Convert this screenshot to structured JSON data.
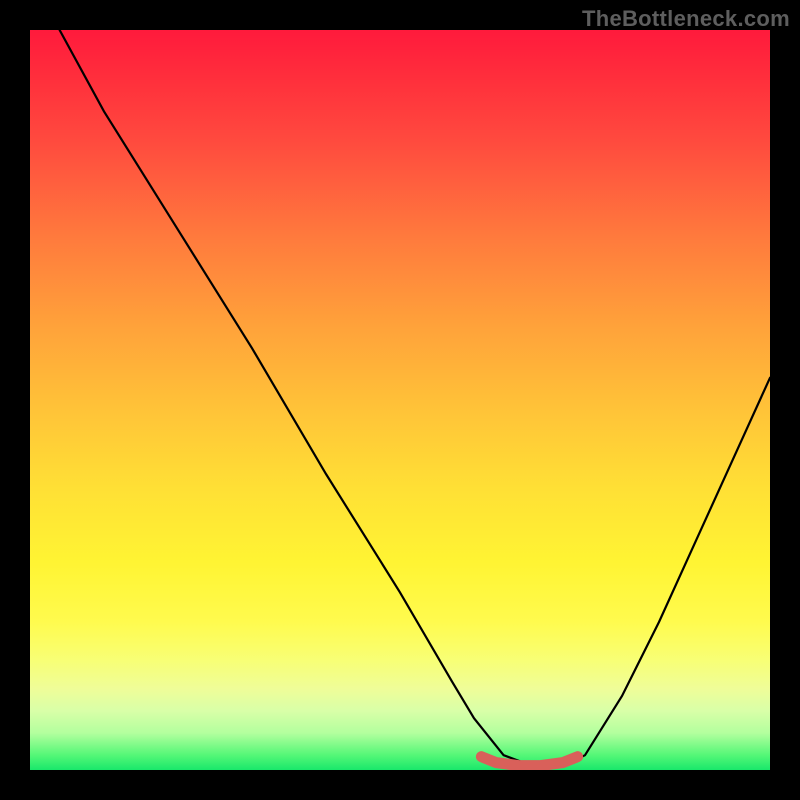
{
  "watermark": "TheBottleneck.com",
  "chart_data": {
    "type": "line",
    "title": "",
    "xlabel": "",
    "ylabel": "",
    "xlim": [
      0,
      100
    ],
    "ylim": [
      0,
      100
    ],
    "grid": false,
    "legend": false,
    "series": [
      {
        "name": "curve",
        "x": [
          4,
          10,
          20,
          30,
          40,
          50,
          57,
          60,
          64,
          68,
          72,
          75,
          80,
          85,
          90,
          95,
          100
        ],
        "values": [
          100,
          89,
          73,
          57,
          40,
          24,
          12,
          7,
          2,
          0.5,
          0.5,
          2,
          10,
          20,
          31,
          42,
          53
        ],
        "color": "#000000"
      },
      {
        "name": "flat-marker",
        "x": [
          61,
          63,
          66,
          69,
          72,
          74
        ],
        "values": [
          1.8,
          1.0,
          0.6,
          0.6,
          1.0,
          1.8
        ],
        "color": "#d9605a"
      }
    ],
    "gradient_stops": [
      {
        "pos": 0,
        "color": "#ff1a3c"
      },
      {
        "pos": 15,
        "color": "#ff4a3e"
      },
      {
        "pos": 40,
        "color": "#ffa23a"
      },
      {
        "pos": 62,
        "color": "#ffe035"
      },
      {
        "pos": 85,
        "color": "#effd98"
      },
      {
        "pos": 100,
        "color": "#19e86b"
      }
    ]
  }
}
